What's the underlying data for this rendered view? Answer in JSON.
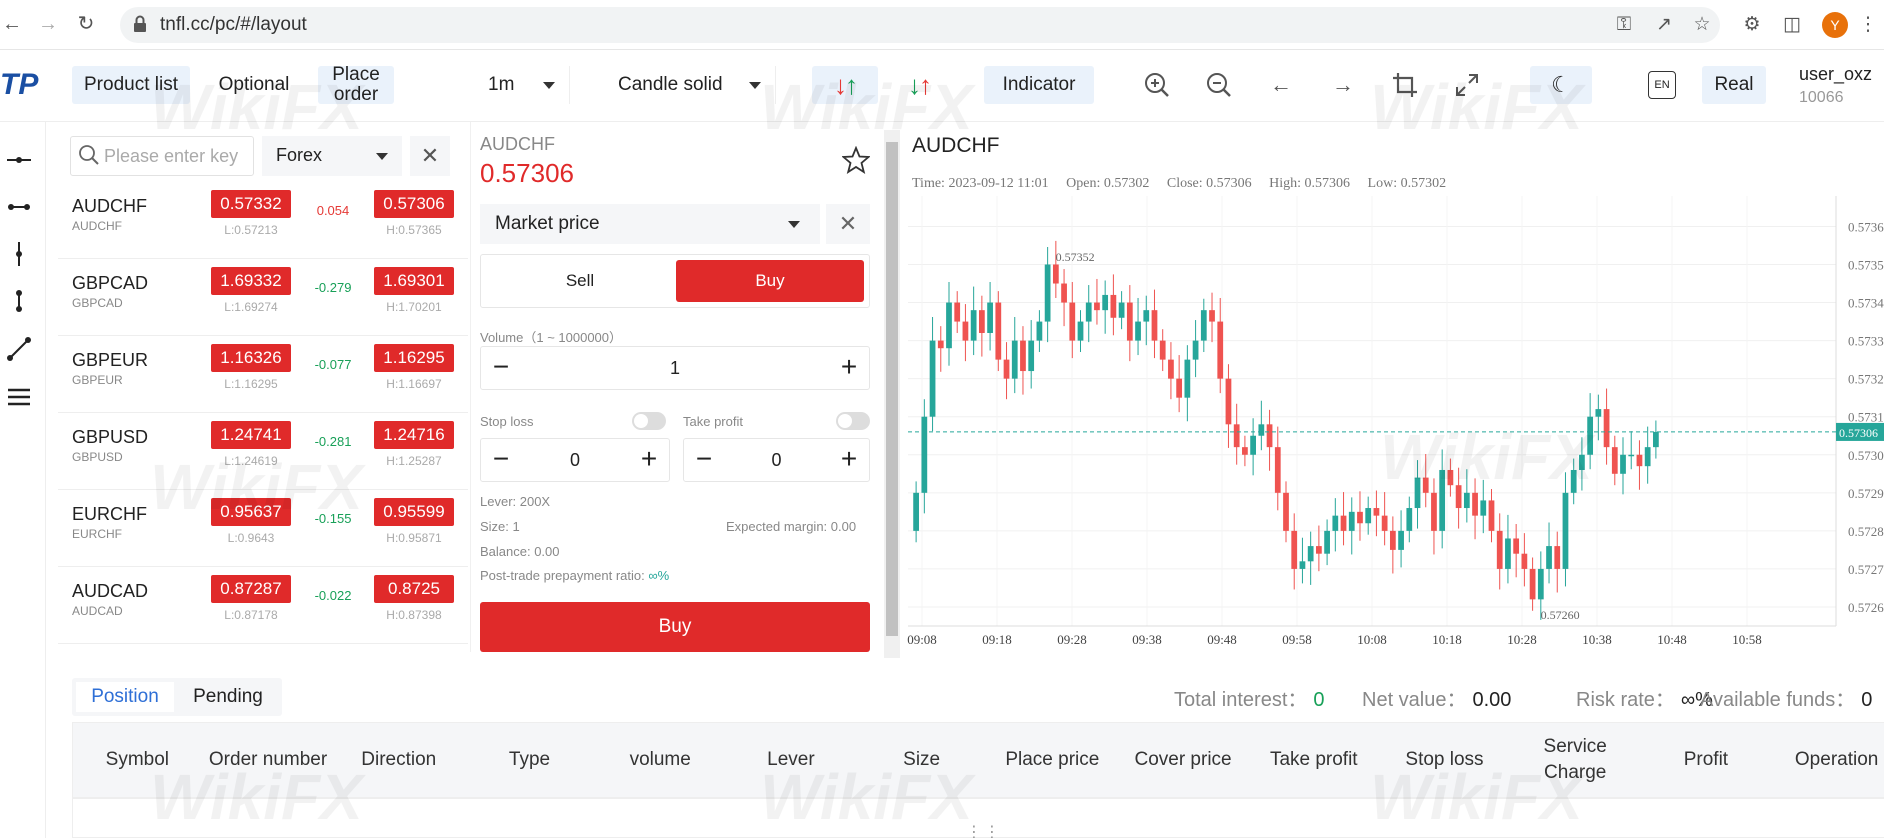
{
  "browser": {
    "url": "tnfl.cc/pc/#/layout",
    "avatar_letter": "Y"
  },
  "toolbar": {
    "product_list": "Product list",
    "optional": "Optional",
    "place_order": "Place order",
    "interval": "1m",
    "chart_type": "Candle solid",
    "indicator": "Indicator",
    "lang_badge": "EN",
    "real": "Real",
    "user_name": "user_oxz",
    "user_id": "10066"
  },
  "product_list": {
    "search_placeholder": "Please enter key",
    "category": "Forex",
    "rows": [
      {
        "symbol": "AUDCHF",
        "sub": "AUDCHF",
        "bid": "0.57332",
        "low": "L:0.57213",
        "change": "0.054",
        "change_dir": "up",
        "ask": "0.57306",
        "high": "H:0.57365"
      },
      {
        "symbol": "GBPCAD",
        "sub": "GBPCAD",
        "bid": "1.69332",
        "low": "L:1.69274",
        "change": "-0.279",
        "change_dir": "down",
        "ask": "1.69301",
        "high": "H:1.70201"
      },
      {
        "symbol": "GBPEUR",
        "sub": "GBPEUR",
        "bid": "1.16326",
        "low": "L:1.16295",
        "change": "-0.077",
        "change_dir": "down",
        "ask": "1.16295",
        "high": "H:1.16697"
      },
      {
        "symbol": "GBPUSD",
        "sub": "GBPUSD",
        "bid": "1.24741",
        "low": "L:1.24619",
        "change": "-0.281",
        "change_dir": "down",
        "ask": "1.24716",
        "high": "H:1.25287"
      },
      {
        "symbol": "EURCHF",
        "sub": "EURCHF",
        "bid": "0.95637",
        "low": "L:0.9643",
        "change": "-0.155",
        "change_dir": "down",
        "ask": "0.95599",
        "high": "H:0.95871"
      },
      {
        "symbol": "AUDCAD",
        "sub": "AUDCAD",
        "bid": "0.87287",
        "low": "L:0.87178",
        "change": "-0.022",
        "change_dir": "down",
        "ask": "0.8725",
        "high": "H:0.87398"
      }
    ]
  },
  "order": {
    "symbol": "AUDCHF",
    "price": "0.57306",
    "price_type": "Market price",
    "sell": "Sell",
    "buy": "Buy",
    "volume_label": "Volume（1 ~ 1000000）",
    "volume": "1",
    "stop_loss_label": "Stop loss",
    "stop_loss": "0",
    "take_profit_label": "Take profit",
    "take_profit": "0",
    "lever": "Lever: 200X",
    "size": "Size:  1",
    "balance": "Balance:  0.00",
    "expected_margin": "Expected margin:  0.00",
    "post_trade": "Post-trade prepayment ratio:",
    "post_trade_value": "∞%",
    "buy_button": "Buy"
  },
  "chart_data": {
    "type": "candlestick",
    "title": "AUDCHF",
    "info": {
      "time": "Time: 2023-09-12 11:01",
      "open": "Open: 0.57302",
      "close": "Close: 0.57306",
      "high": "High: 0.57306",
      "low": "Low: 0.57302"
    },
    "x_ticks": [
      "09:08",
      "09:18",
      "09:28",
      "09:38",
      "09:48",
      "09:58",
      "10:08",
      "10:18",
      "10:28",
      "10:38",
      "10:48",
      "10:58"
    ],
    "y_ticks": [
      "0.5736",
      "0.5735",
      "0.5734",
      "0.5733",
      "0.5732",
      "0.5731",
      "0.5730",
      "0.5729",
      "0.5728",
      "0.5727",
      "0.5726"
    ],
    "ylim": [
      0.57255,
      0.57368
    ],
    "current_price": "0.57306",
    "current_value": 0.57306,
    "max_label": "0.57352",
    "max_value": 0.57352,
    "min_label": "0.57260",
    "min_value": 0.5726,
    "up_color": "#26a69a",
    "down_color": "#ef5350",
    "closes": [
      0.5729,
      0.5731,
      0.5733,
      0.57328,
      0.5734,
      0.57335,
      0.5733,
      0.57338,
      0.57332,
      0.5734,
      0.57325,
      0.5732,
      0.5733,
      0.57322,
      0.5733,
      0.57335,
      0.5735,
      0.57345,
      0.5734,
      0.5733,
      0.57335,
      0.5734,
      0.57338,
      0.57342,
      0.57336,
      0.5734,
      0.5733,
      0.57335,
      0.57338,
      0.5733,
      0.57325,
      0.5732,
      0.57315,
      0.57325,
      0.5733,
      0.57338,
      0.57335,
      0.5732,
      0.57308,
      0.57302,
      0.573,
      0.57305,
      0.57308,
      0.57302,
      0.5729,
      0.5728,
      0.5727,
      0.57272,
      0.57276,
      0.57274,
      0.5728,
      0.57284,
      0.5728,
      0.57285,
      0.57282,
      0.57286,
      0.57284,
      0.5728,
      0.57275,
      0.5728,
      0.57286,
      0.57294,
      0.5729,
      0.5728,
      0.57296,
      0.57292,
      0.57286,
      0.5729,
      0.57284,
      0.57288,
      0.5728,
      0.5727,
      0.57278,
      0.57274,
      0.5727,
      0.57262,
      0.5727,
      0.57276,
      0.5727,
      0.5729,
      0.57296,
      0.573,
      0.5731,
      0.57312,
      0.57302,
      0.57295,
      0.573,
      0.573,
      0.57297,
      0.57302,
      0.57306
    ]
  },
  "bottom": {
    "tab_position": "Position",
    "tab_pending": "Pending",
    "total_interest_label": "Total interest：",
    "total_interest": "0",
    "net_value_label": "Net value：",
    "net_value": "0.00",
    "risk_rate_label": "Risk rate：",
    "risk_rate": "∞%",
    "available_label": "Available funds：",
    "available": "0",
    "columns": [
      "Symbol",
      "Order number",
      "Direction",
      "Type",
      "volume",
      "Lever",
      "Size",
      "Place price",
      "Cover price",
      "Take profit",
      "Stop loss",
      "Service Charge",
      "Profit",
      "Operation"
    ]
  },
  "watermark": "WikiFX"
}
